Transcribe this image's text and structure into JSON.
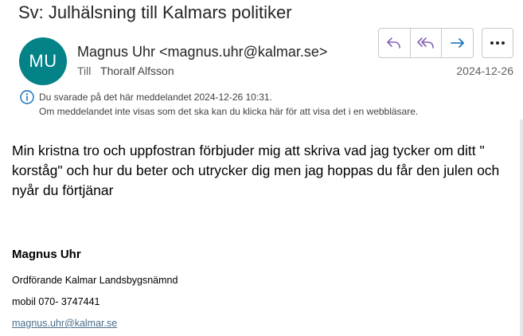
{
  "email": {
    "subject": "Sv: Julhälsning till Kalmars politiker",
    "avatar_initials": "MU",
    "avatar_color": "#038387",
    "sender": "Magnus Uhr <magnus.uhr@kalmar.se>",
    "to_label": "Till",
    "to_name": "Thoralf Alfsson",
    "date": "2024-12-26",
    "info_icon": "info-icon",
    "info_line1": "Du svarade på det här meddelandet 2024-12-26 10:31.",
    "info_line2": "Om meddelandet inte visas som det ska kan du klicka här för att visa det i en webbläsare.",
    "body": "Min kristna tro och uppfostran förbjuder mig att skriva vad jag tycker om ditt \" korståg\" och hur du beter och utrycker dig men jag hoppas du får den julen och nyår du förtjänar",
    "signature": {
      "name": "Magnus Uhr",
      "title": "Ordförande Kalmar Landsbygsnämnd",
      "phone": "mobil 070- 3747441",
      "email": "magnus.uhr@kalmar.se"
    }
  },
  "actions": {
    "reply_icon": "reply-icon",
    "reply_all_icon": "reply-all-icon",
    "forward_icon": "forward-icon",
    "more_icon": "more-icon",
    "accent_color": "#8764b8",
    "forward_color": "#0f6cbd"
  }
}
